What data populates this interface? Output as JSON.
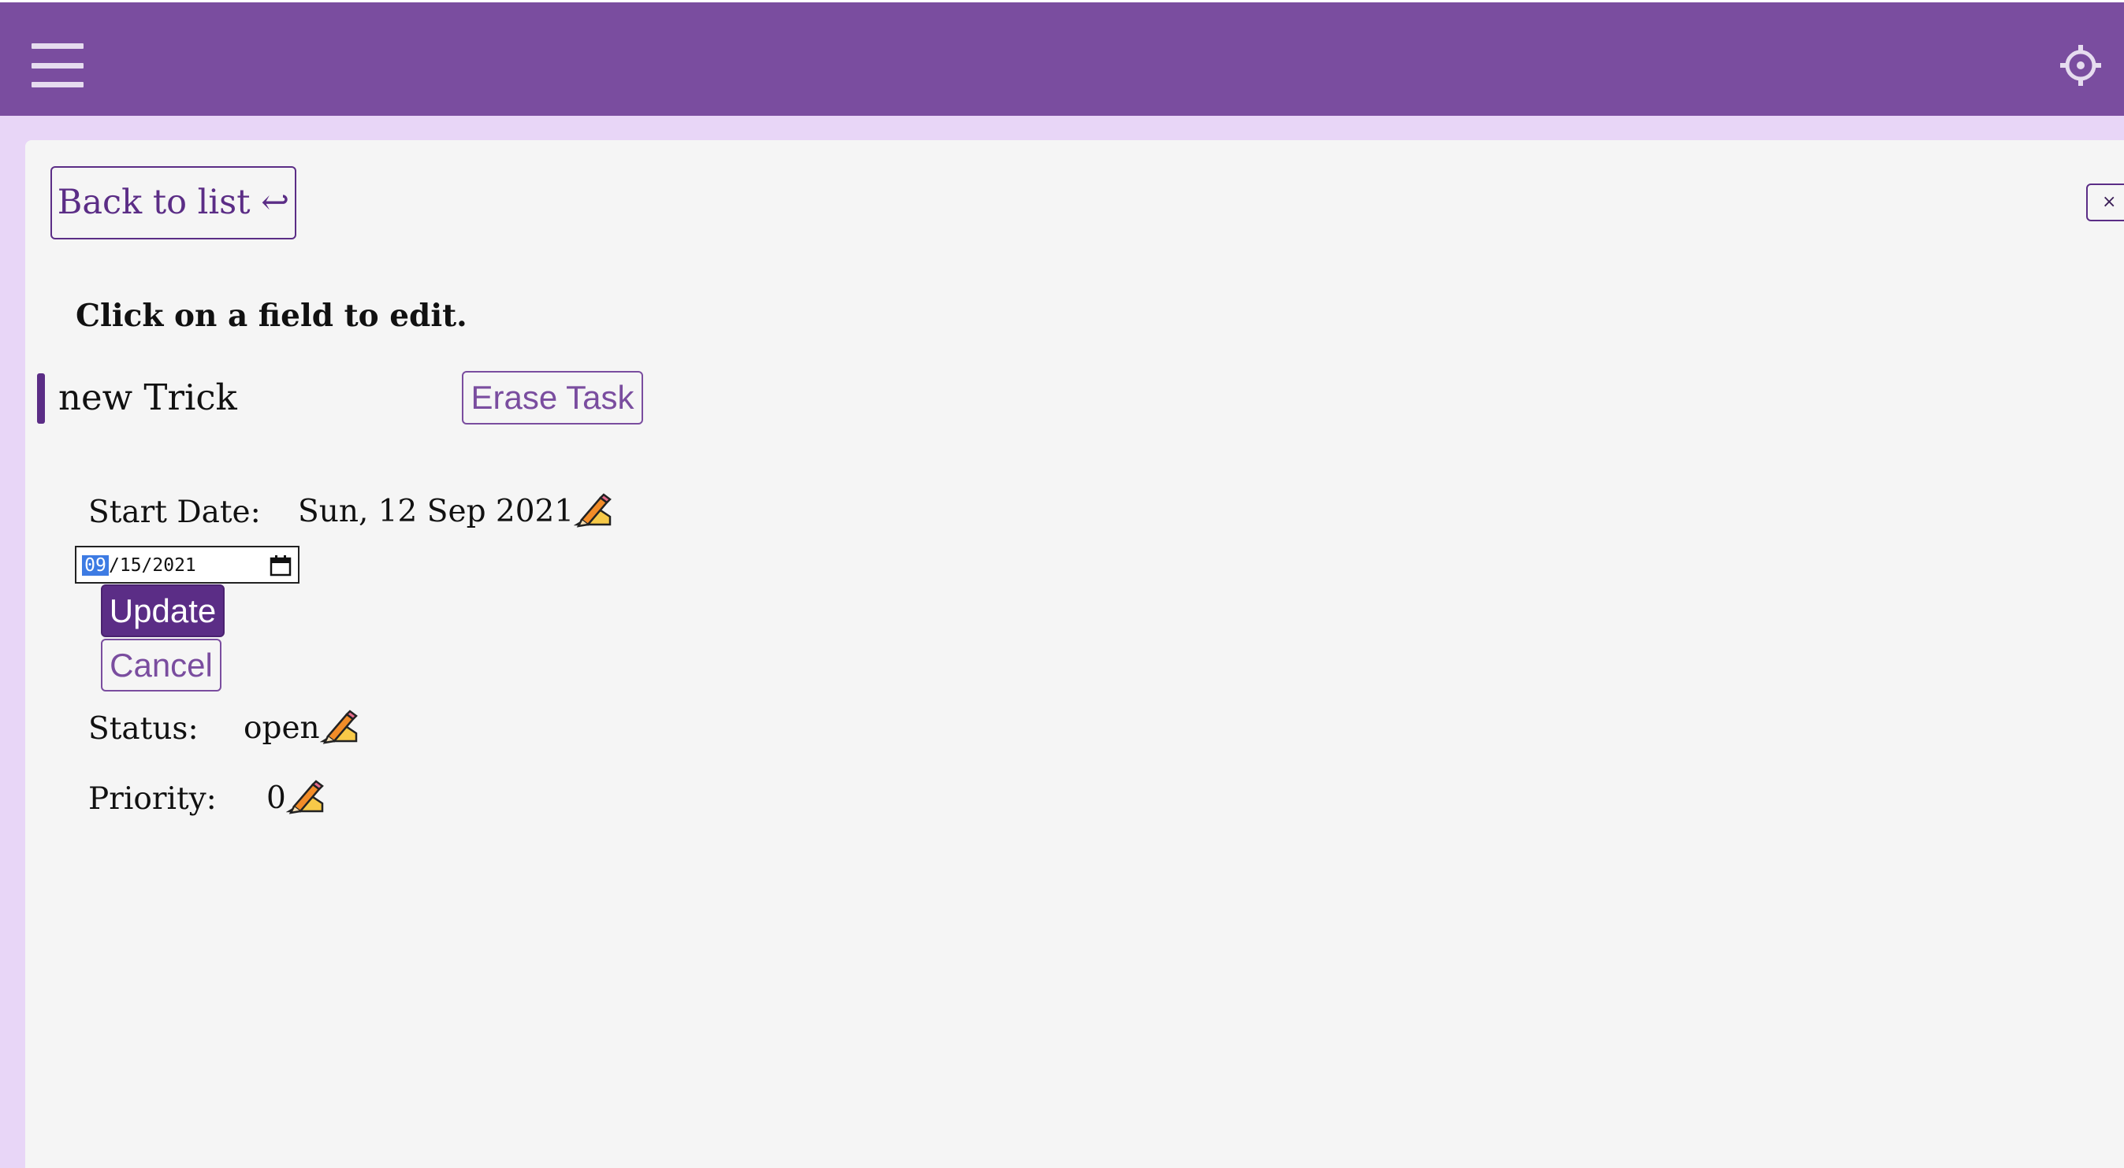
{
  "header": {
    "menu_icon": "hamburger-menu-icon",
    "settings_icon": "gear-icon",
    "background_color": "#7a4d9f"
  },
  "detail": {
    "back_label": "Back to list ↩",
    "close_label": "×",
    "hint": "Click on a field to edit.",
    "task_name": "new Trick",
    "erase_label": "Erase Task"
  },
  "fields": {
    "start_date": {
      "label": "Start Date:",
      "value": "Sun, 12 Sep 2021",
      "edit_icon": "pencil-icon"
    },
    "status": {
      "label": "Status:",
      "value": "open",
      "edit_icon": "pencil-icon"
    },
    "priority": {
      "label": "Priority:",
      "value": "0",
      "edit_icon": "pencil-icon"
    }
  },
  "editor": {
    "date_month": "09",
    "date_rest": "/15/2021",
    "calendar_icon": "calendar-icon",
    "update_label": "Update",
    "cancel_label": "Cancel"
  },
  "colors": {
    "accent": "#5b2d86",
    "accent_light": "#7a4d9f",
    "page_band": "#e8d6f7",
    "card_bg": "#f5f5f5"
  }
}
